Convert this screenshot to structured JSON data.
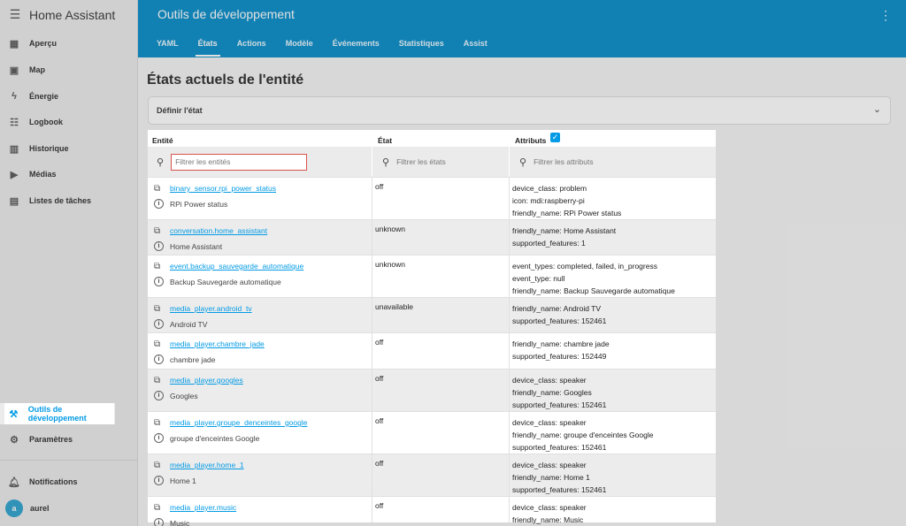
{
  "app": {
    "title": "Home Assistant"
  },
  "sidebar": {
    "items": [
      {
        "label": "Aperçu",
        "icon": "dashboard-icon"
      },
      {
        "label": "Map",
        "icon": "map-icon"
      },
      {
        "label": "Énergie",
        "icon": "lightning-icon"
      },
      {
        "label": "Logbook",
        "icon": "list-icon"
      },
      {
        "label": "Historique",
        "icon": "chart-icon"
      },
      {
        "label": "Médias",
        "icon": "media-icon"
      },
      {
        "label": "Listes de tâches",
        "icon": "clipboard-icon"
      }
    ],
    "dev_tools": "Outils de développement",
    "settings": "Paramètres",
    "notifications": "Notifications",
    "user": {
      "initial": "a",
      "name": "aurel"
    }
  },
  "header": {
    "title": "Outils de développement",
    "tabs": [
      "YAML",
      "États",
      "Actions",
      "Modèle",
      "Événements",
      "Statistiques",
      "Assist"
    ],
    "active_tab": "États"
  },
  "main": {
    "title": "États actuels de l'entité",
    "define_state": "Définir l'état"
  },
  "table": {
    "headers": {
      "entity": "Entité",
      "state": "État",
      "attributes": "Attributs"
    },
    "filters": {
      "entity": "Filtrer les entités",
      "state": "Filtrer les états",
      "attributes": "Filtrer les attributs"
    },
    "rows": [
      {
        "id": "binary_sensor.rpi_power_status",
        "name": "RPi Power status",
        "state": "off",
        "attrs": [
          "device_class: problem",
          "icon: mdi:raspberry-pi",
          "friendly_name: RPi Power status"
        ]
      },
      {
        "id": "conversation.home_assistant",
        "name": "Home Assistant",
        "state": "unknown",
        "attrs": [
          "friendly_name: Home Assistant",
          "supported_features: 1"
        ]
      },
      {
        "id": "event.backup_sauvegarde_automatique",
        "name": "Backup Sauvegarde automatique",
        "state": "unknown",
        "attrs": [
          "event_types: completed, failed, in_progress",
          "event_type: null",
          "friendly_name: Backup Sauvegarde automatique"
        ]
      },
      {
        "id": "media_player.android_tv",
        "name": "Android TV",
        "state": "unavailable",
        "attrs": [
          "friendly_name: Android TV",
          "supported_features: 152461"
        ]
      },
      {
        "id": "media_player.chambre_jade",
        "name": "chambre jade",
        "state": "off",
        "attrs": [
          "friendly_name: chambre jade",
          "supported_features: 152449"
        ]
      },
      {
        "id": "media_player.googles",
        "name": "Googles",
        "state": "off",
        "attrs": [
          "device_class: speaker",
          "friendly_name: Googles",
          "supported_features: 152461"
        ]
      },
      {
        "id": "media_player.groupe_denceintes_google",
        "name": "groupe d'enceintes Google",
        "state": "off",
        "attrs": [
          "device_class: speaker",
          "friendly_name: groupe d'enceintes Google",
          "supported_features: 152461"
        ]
      },
      {
        "id": "media_player.home_1",
        "name": "Home 1",
        "state": "off",
        "attrs": [
          "device_class: speaker",
          "friendly_name: Home 1",
          "supported_features: 152461"
        ]
      },
      {
        "id": "media_player.music",
        "name": "Music",
        "state": "off",
        "attrs": [
          "device_class: speaker",
          "friendly_name: Music"
        ]
      }
    ]
  },
  "colors": {
    "primary": "#03a9f4",
    "accent": "#039be5",
    "focus_border": "#d9534f"
  }
}
